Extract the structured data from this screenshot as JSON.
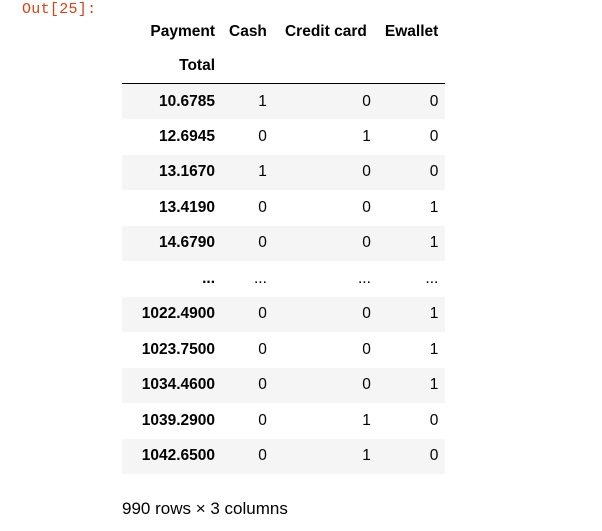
{
  "prompt": "Out[25]:",
  "table": {
    "columns_label": "Payment",
    "index_name": "Total",
    "columns": [
      "Cash",
      "Credit card",
      "Ewallet"
    ],
    "rows": [
      {
        "index": "10.6785",
        "values": [
          "1",
          "0",
          "0"
        ]
      },
      {
        "index": "12.6945",
        "values": [
          "0",
          "1",
          "0"
        ]
      },
      {
        "index": "13.1670",
        "values": [
          "1",
          "0",
          "0"
        ]
      },
      {
        "index": "13.4190",
        "values": [
          "0",
          "0",
          "1"
        ]
      },
      {
        "index": "14.6790",
        "values": [
          "0",
          "0",
          "1"
        ]
      },
      {
        "index": "...",
        "values": [
          "...",
          "...",
          "..."
        ]
      },
      {
        "index": "1022.4900",
        "values": [
          "0",
          "0",
          "1"
        ]
      },
      {
        "index": "1023.7500",
        "values": [
          "0",
          "0",
          "1"
        ]
      },
      {
        "index": "1034.4600",
        "values": [
          "0",
          "0",
          "1"
        ]
      },
      {
        "index": "1039.2900",
        "values": [
          "0",
          "1",
          "0"
        ]
      },
      {
        "index": "1042.6500",
        "values": [
          "0",
          "1",
          "0"
        ]
      }
    ]
  },
  "shape": "990 rows × 3 columns"
}
